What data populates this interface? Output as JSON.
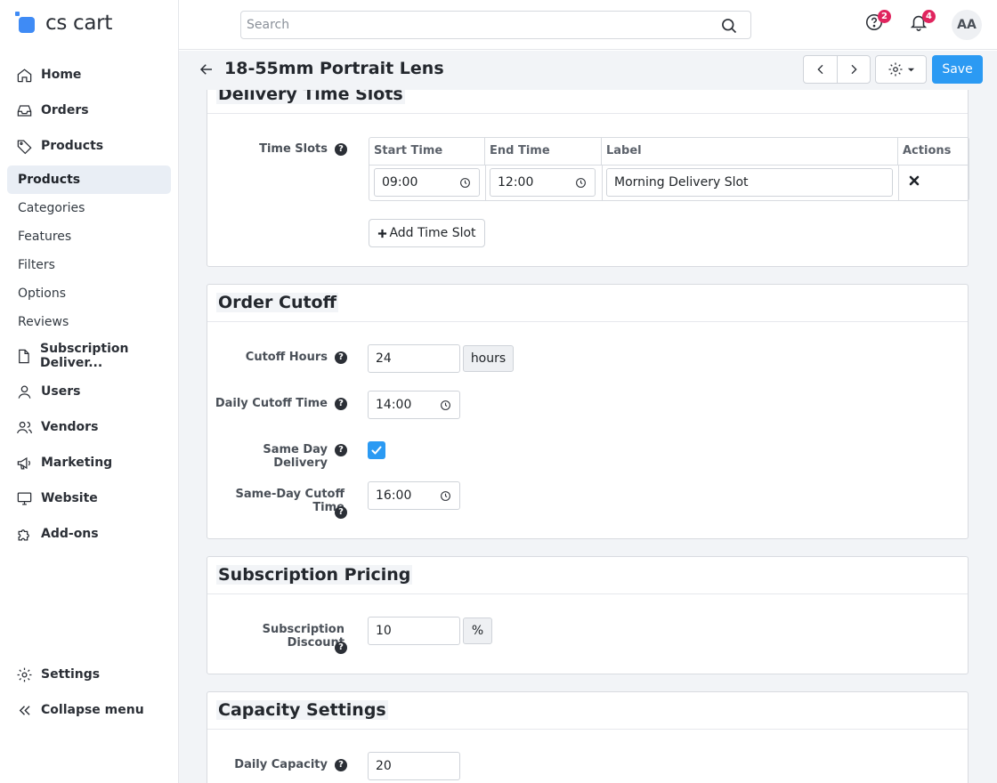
{
  "app": {
    "logo_text": "cs cart"
  },
  "sidebar": {
    "items": [
      {
        "label": "Home"
      },
      {
        "label": "Orders"
      },
      {
        "label": "Products"
      }
    ],
    "sub_items": [
      {
        "label": "Products",
        "active": true
      },
      {
        "label": "Categories"
      },
      {
        "label": "Features"
      },
      {
        "label": "Filters"
      },
      {
        "label": "Options"
      },
      {
        "label": "Reviews"
      }
    ],
    "items_after": [
      {
        "label": "Subscription Deliver..."
      },
      {
        "label": "Users"
      },
      {
        "label": "Vendors"
      },
      {
        "label": "Marketing"
      },
      {
        "label": "Website"
      },
      {
        "label": "Add-ons"
      }
    ],
    "bottom": [
      {
        "label": "Settings"
      },
      {
        "label": "Collapse menu"
      }
    ]
  },
  "topbar": {
    "search_placeholder": "Search",
    "help_badge": "2",
    "notifications_badge": "4",
    "avatar": "AA"
  },
  "titlebar": {
    "title": "18-55mm Portrait Lens",
    "save_label": "Save"
  },
  "delivery_time_slots": {
    "title": "Delivery Time Slots",
    "field_label": "Time Slots",
    "columns": [
      "Start Time",
      "End Time",
      "Label",
      "Actions"
    ],
    "rows": [
      {
        "start": "09:00",
        "end": "12:00",
        "label": "Morning Delivery Slot"
      }
    ],
    "add_button": "Add Time Slot"
  },
  "order_cutoff": {
    "title": "Order Cutoff",
    "cutoff_hours_label": "Cutoff Hours",
    "cutoff_hours_value": "24",
    "cutoff_hours_unit": "hours",
    "daily_cutoff_label": "Daily Cutoff Time",
    "daily_cutoff_value": "14:00",
    "same_day_label": "Same Day Delivery",
    "same_day_checked": true,
    "same_day_cutoff_label": "Same-Day Cutoff Time",
    "same_day_cutoff_value": "16:00"
  },
  "subscription_pricing": {
    "title": "Subscription Pricing",
    "discount_label": "Subscription Discount",
    "discount_value": "10",
    "discount_unit": "%"
  },
  "capacity_settings": {
    "title": "Capacity Settings",
    "daily_capacity_label": "Daily Capacity",
    "daily_capacity_value": "20"
  },
  "colors": {
    "accent": "#2b9af3",
    "badge": "#e0245e",
    "content_bg": "#f2f4f7"
  }
}
